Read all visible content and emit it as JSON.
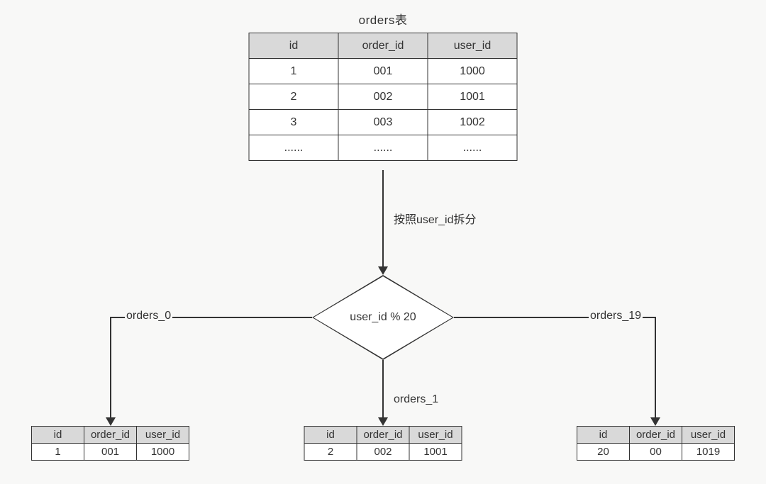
{
  "title": "orders表",
  "mainTable": {
    "headers": [
      "id",
      "order_id",
      "user_id"
    ],
    "rows": [
      [
        "1",
        "001",
        "1000"
      ],
      [
        "2",
        "002",
        "1001"
      ],
      [
        "3",
        "003",
        "1002"
      ],
      [
        "......",
        "......",
        "......"
      ]
    ]
  },
  "splitLabel": "按照user_id拆分",
  "decision": "user_id % 20",
  "branches": {
    "left": {
      "label": "orders_0"
    },
    "center": {
      "label": "orders_1"
    },
    "right": {
      "label": "orders_19"
    }
  },
  "shards": {
    "left": {
      "headers": [
        "id",
        "order_id",
        "user_id"
      ],
      "rows": [
        [
          "1",
          "001",
          "1000"
        ]
      ]
    },
    "center": {
      "headers": [
        "id",
        "order_id",
        "user_id"
      ],
      "rows": [
        [
          "2",
          "002",
          "1001"
        ]
      ]
    },
    "right": {
      "headers": [
        "id",
        "order_id",
        "user_id"
      ],
      "rows": [
        [
          "20",
          "00",
          "1019"
        ]
      ]
    }
  }
}
